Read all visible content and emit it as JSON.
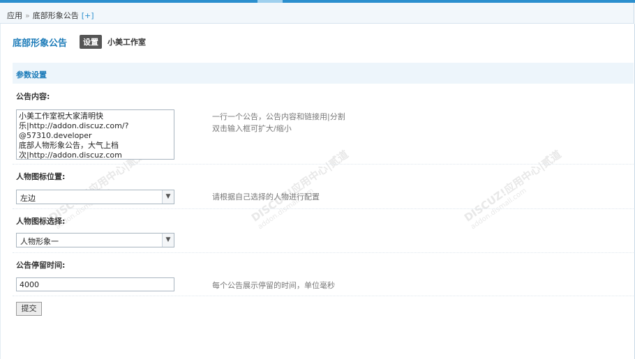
{
  "breadcrumb": {
    "root": "应用",
    "separator": "»",
    "current": "底部形象公告",
    "add_link": "[+]"
  },
  "page": {
    "title": "底部形象公告",
    "tab_active": "设置",
    "tab_other": "小美工作室"
  },
  "section": {
    "title": "参数设置"
  },
  "fields": {
    "content": {
      "label": "公告内容:",
      "value": "小美工作室祝大家清明快乐|http://addon.discuz.com/?@57310.developer\n底部人物形象公告，大气上档次|http://addon.discuz.com",
      "hint1": "一行一个公告，公告内容和链接用|分割",
      "hint2": "双击输入框可扩大/缩小"
    },
    "icon_position": {
      "label": "人物图标位置:",
      "value": "左边",
      "hint": "请根据自己选择的人物进行配置"
    },
    "icon_select": {
      "label": "人物图标选择:",
      "value": "人物形象一"
    },
    "stay_time": {
      "label": "公告停留时间:",
      "value": "4000",
      "hint": "每个公告展示停留的时间，单位毫秒"
    }
  },
  "submit": {
    "label": "提交"
  },
  "watermark": {
    "line1": "DISCUZ!应用中心|贰道",
    "line2": "addon.dismall.com"
  },
  "colors": {
    "accent": "#1a7ab8",
    "top_bar": "#2b8fce",
    "section_bg": "#edf5fb"
  }
}
